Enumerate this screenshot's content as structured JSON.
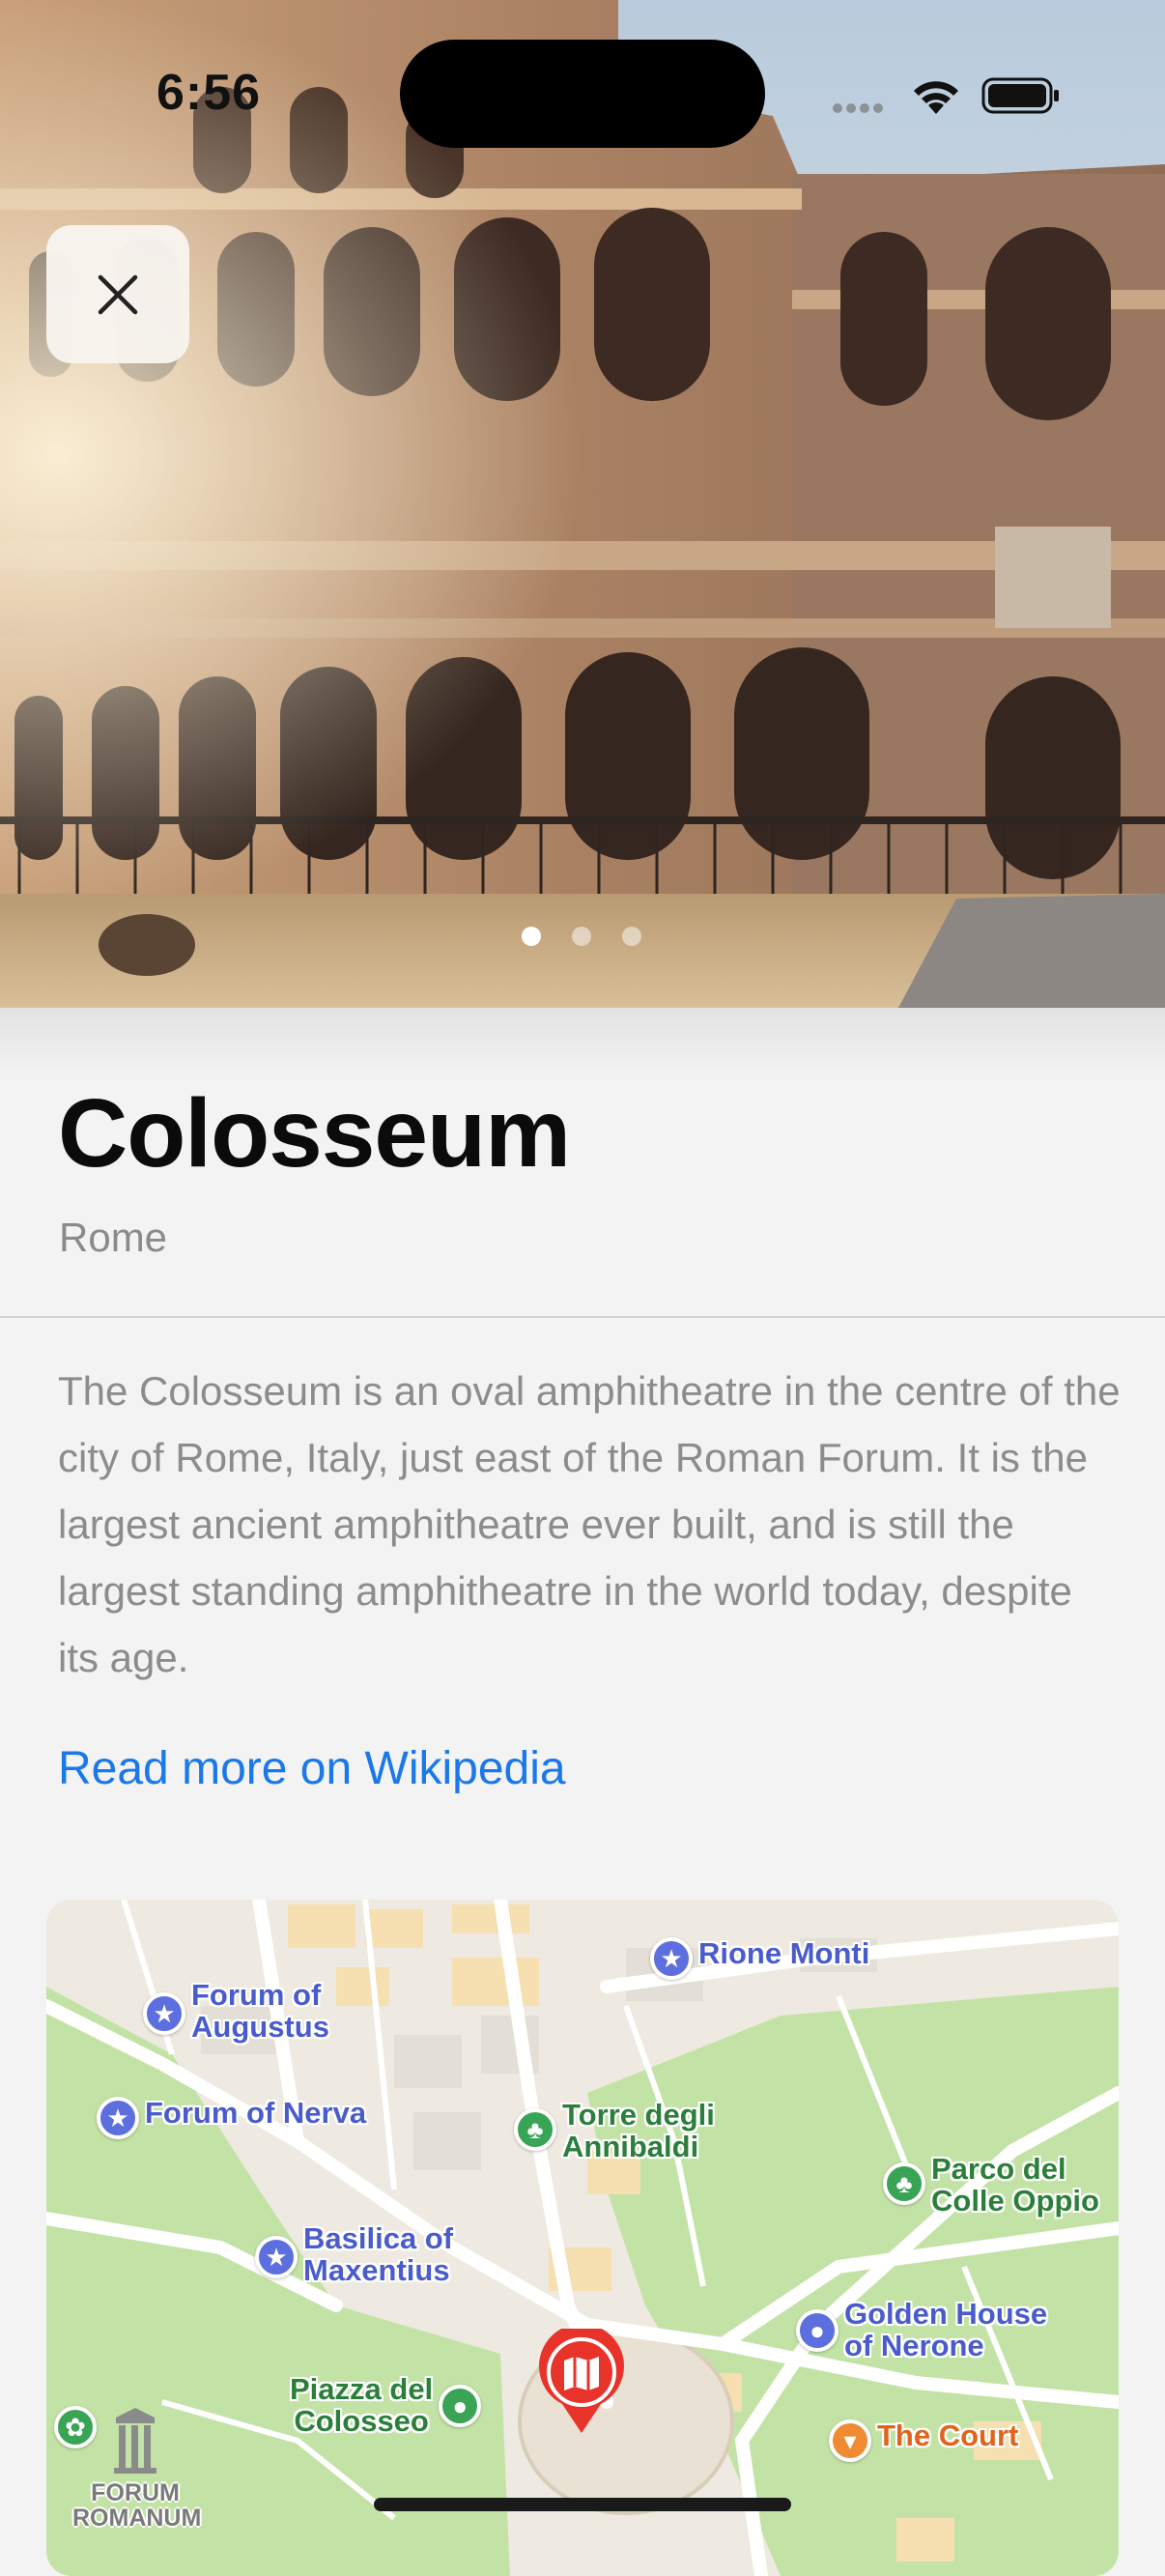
{
  "status_bar": {
    "time": "6:56"
  },
  "hero": {
    "pager": {
      "count": 3,
      "active_index": 0
    }
  },
  "place": {
    "title": "Colosseum",
    "subtitle": "Rome",
    "description": "The Colosseum is an oval amphitheatre in the centre of the city of Rome, Italy, just east of the Roman Forum. It is the largest ancient amphitheatre ever built, and is still the largest standing amphitheatre in the world today, despite its age.",
    "link_label": "Read more on Wikipedia"
  },
  "map": {
    "pois": {
      "rione_monti": "Rione Monti",
      "forum_augustus": "Forum of\nAugustus",
      "forum_nerva": "Forum of Nerva",
      "torre": "Torre degli\nAnnibaldi",
      "parco": "Parco del\nColle Oppio",
      "basilica": "Basilica of\nMaxentius",
      "golden_house": "Golden House\nof Nerone",
      "piazza": "Piazza del\nColosseo",
      "the_court": "The Court",
      "forum_romanum": "FORUM\nROMANUM"
    },
    "icons": {
      "landmark": "star-icon",
      "park": "tree-icon",
      "bar": "cocktail-icon",
      "pin": "map-pin-icon"
    }
  },
  "colors": {
    "link": "#1a78ea",
    "poi_blue": "#5d6fde",
    "poi_green": "#3aa456",
    "poi_orange": "#f08a33",
    "pin_red": "#e8332a"
  }
}
